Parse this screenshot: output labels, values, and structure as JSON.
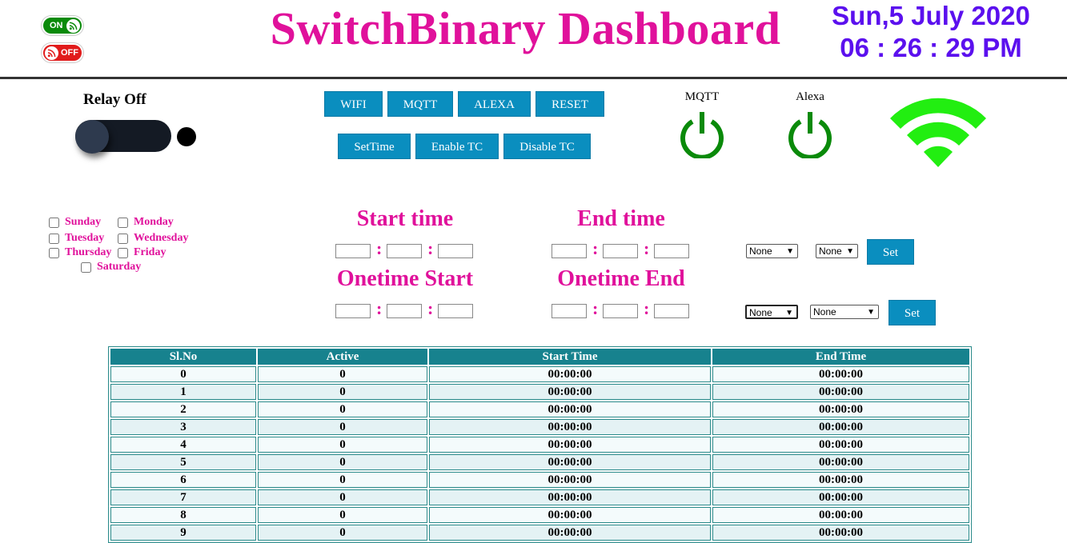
{
  "header": {
    "title": "SwitchBinary Dashboard",
    "date": "Sun,5 July 2020",
    "time": "06 : 26 : 29 PM",
    "logo_on": "ON",
    "logo_off": "OFF"
  },
  "relay": {
    "label": "Relay Off",
    "state": "off"
  },
  "buttons": {
    "row1": [
      "WIFI",
      "MQTT",
      "ALEXA",
      "RESET"
    ],
    "row2": [
      "SetTime",
      "Enable TC",
      "Disable TC"
    ]
  },
  "status": {
    "mqtt_label": "MQTT",
    "alexa_label": "Alexa",
    "colors": {
      "power": "#0a8a0a",
      "wifi": "#22ee11"
    }
  },
  "days": [
    "Sunday",
    "Monday",
    "Tuesday",
    "Wednesday",
    "Thursday",
    "Friday",
    "Saturday"
  ],
  "schedule": {
    "start_time": "Start time",
    "end_time": "End time",
    "onetime_start": "Onetime Start",
    "onetime_end": "Onetime End",
    "select_value": "None",
    "set_label": "Set"
  },
  "table": {
    "headers": [
      "Sl.No",
      "Active",
      "Start Time",
      "End Time"
    ],
    "rows": [
      [
        "0",
        "0",
        "00:00:00",
        "00:00:00"
      ],
      [
        "1",
        "0",
        "00:00:00",
        "00:00:00"
      ],
      [
        "2",
        "0",
        "00:00:00",
        "00:00:00"
      ],
      [
        "3",
        "0",
        "00:00:00",
        "00:00:00"
      ],
      [
        "4",
        "0",
        "00:00:00",
        "00:00:00"
      ],
      [
        "5",
        "0",
        "00:00:00",
        "00:00:00"
      ],
      [
        "6",
        "0",
        "00:00:00",
        "00:00:00"
      ],
      [
        "7",
        "0",
        "00:00:00",
        "00:00:00"
      ],
      [
        "8",
        "0",
        "00:00:00",
        "00:00:00"
      ],
      [
        "9",
        "0",
        "00:00:00",
        "00:00:00"
      ]
    ]
  },
  "colors": {
    "accent": "#e0119b",
    "date": "#5b10ee",
    "button": "#0a8ebf",
    "table_header": "#17828e"
  }
}
